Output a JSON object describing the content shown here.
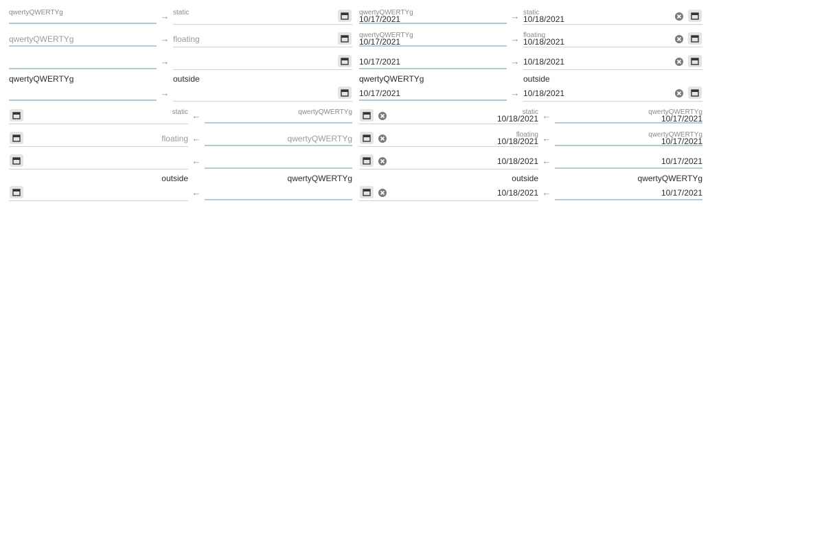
{
  "placeholders": {
    "start": "qwertyQWERTYg",
    "static": "static",
    "floating": "floating",
    "outside": "outside"
  },
  "values": {
    "start_date": "10/17/2021",
    "end_date": "10/18/2021"
  },
  "icons": {
    "calendar": "calendar-icon",
    "clear": "clear-icon",
    "arrow_right": "arrow-right-icon",
    "arrow_left": "arrow-left-icon"
  }
}
